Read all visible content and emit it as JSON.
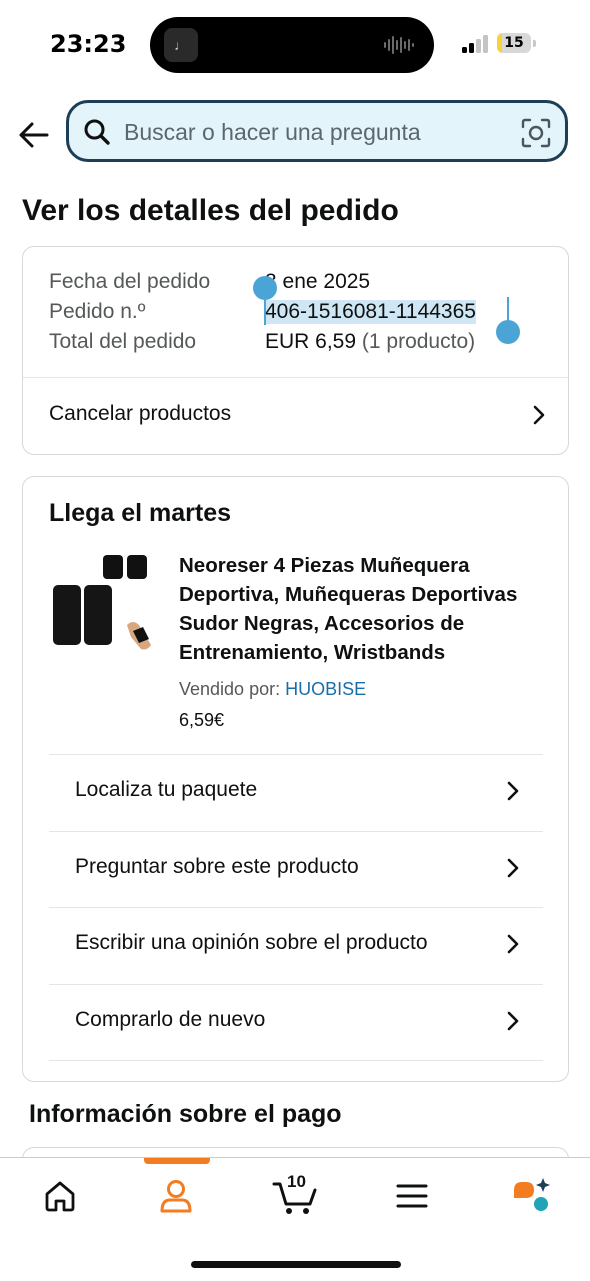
{
  "status_bar": {
    "time": "23:23",
    "island_app_glyph": "♩",
    "battery_level": "15",
    "battery_fraction": 0.15
  },
  "search": {
    "placeholder": "Buscar o hacer una pregunta"
  },
  "page": {
    "title": "Ver los detalles del pedido"
  },
  "order_summary": {
    "date_label": "Fecha del pedido",
    "date_value": "3 ene 2025",
    "number_label": "Pedido n.º",
    "number_value": "406-1516081-1144365",
    "total_label": "Total del pedido",
    "total_value": "EUR 6,59",
    "total_count": "(1 producto)",
    "cancel_label": "Cancelar productos"
  },
  "shipment": {
    "heading": "Llega el martes",
    "product_title": "Neoreser 4 Piezas Muñequera Deportiva, Muñequeras Deportivas Sudor Negras, Accesorios de Entrenamiento, Wristbands",
    "seller_prefix": "Vendido por: ",
    "seller_name": "HUOBISE",
    "price": "6,59€",
    "actions": [
      {
        "label": "Localiza tu paquete"
      },
      {
        "label": "Preguntar sobre este producto"
      },
      {
        "label": "Escribir una opinión sobre el producto"
      },
      {
        "label": "Comprarlo de nuevo"
      }
    ]
  },
  "payment": {
    "heading": "Información sobre el pago"
  },
  "bottom_nav": {
    "cart_count": "10",
    "accent_color": "#f47c20",
    "items": [
      "home-icon",
      "account-icon",
      "cart-icon",
      "menu-icon",
      "rufus-assistant-icon"
    ]
  }
}
